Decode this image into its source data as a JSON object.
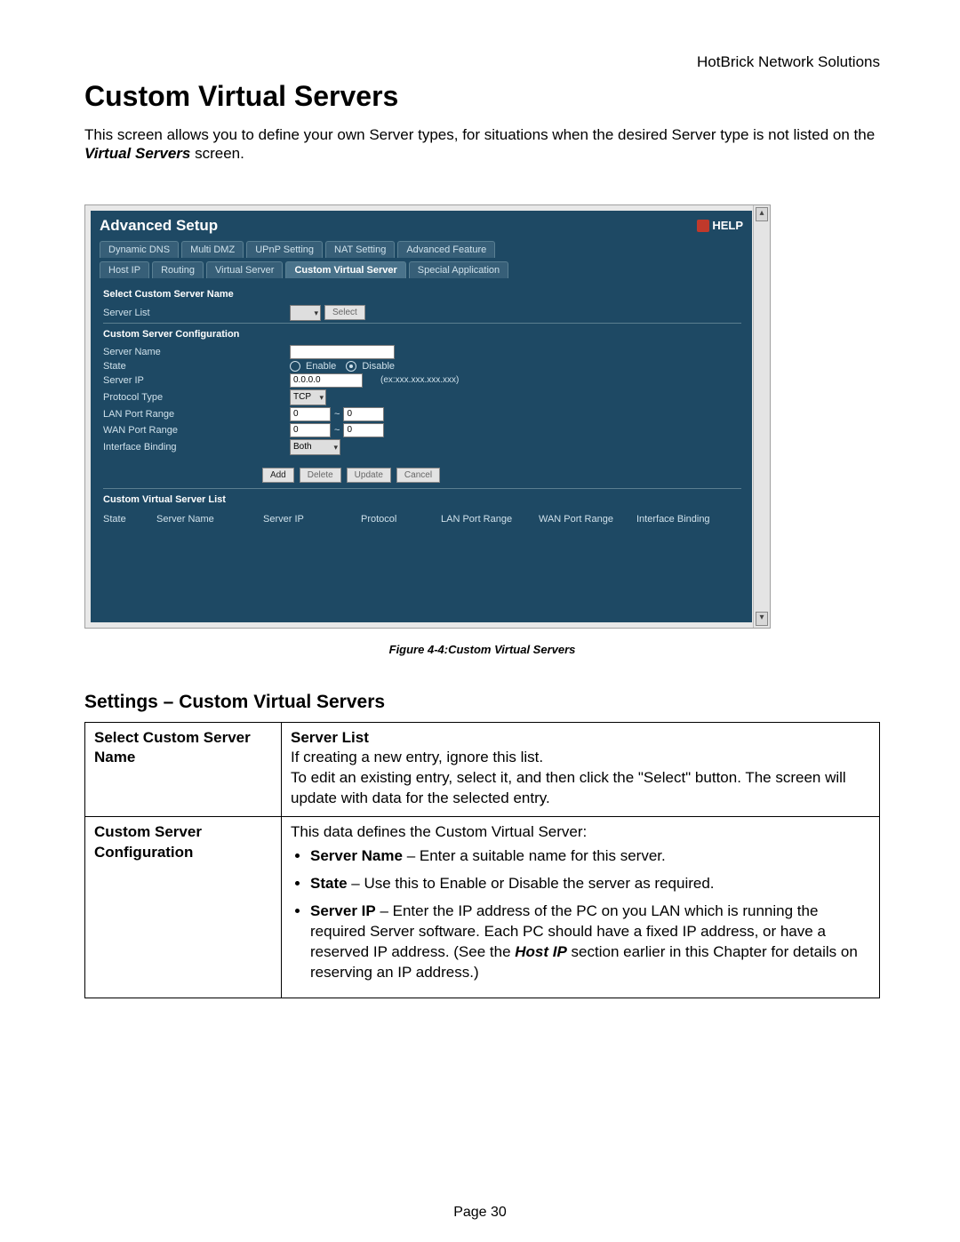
{
  "header": {
    "company": "HotBrick Network Solutions"
  },
  "title": "Custom Virtual Servers",
  "intro": {
    "line1": "This screen allows you to define your own Server types, for situations when the desired Server type is not listed on the ",
    "line1_bold": "Virtual Servers",
    "line1_after": " screen."
  },
  "screenshot": {
    "panel_title": "Advanced Setup",
    "help_label": "HELP",
    "tabs1": [
      "Dynamic DNS",
      "Multi DMZ",
      "UPnP Setting",
      "NAT Setting",
      "Advanced Feature"
    ],
    "tabs2": [
      "Host IP",
      "Routing",
      "Virtual Server",
      "Custom Virtual Server",
      "Special Application"
    ],
    "active_tab2_index": 3,
    "sec_select_head": "Select Custom Server Name",
    "server_list_label": "Server List",
    "select_btn": "Select",
    "sec_config_head": "Custom Server Configuration",
    "rows": {
      "server_name": "Server Name",
      "state": "State",
      "enable": "Enable",
      "disable": "Disable",
      "server_ip": "Server IP",
      "server_ip_val": "0.0.0.0",
      "ip_hint": "(ex:xxx.xxx.xxx.xxx)",
      "protocol_type": "Protocol Type",
      "protocol_val": "TCP",
      "lan_port": "LAN Port Range",
      "wan_port": "WAN Port Range",
      "port_default": "0",
      "tilde": "~",
      "iface": "Interface Binding",
      "iface_val": "Both"
    },
    "buttons": {
      "add": "Add",
      "delete": "Delete",
      "update": "Update",
      "cancel": "Cancel"
    },
    "sec_list_head": "Custom Virtual Server List",
    "list_cols": [
      "State",
      "Server Name",
      "Server IP",
      "Protocol",
      "LAN Port Range",
      "WAN Port Range",
      "Interface Binding"
    ]
  },
  "fig_caption": "Figure 4-4:Custom Virtual Servers",
  "settings_header": "Settings – Custom Virtual Servers",
  "table": {
    "r1_left": "Select Custom Server Name",
    "r1_right_head": "Server List",
    "r1_right_l1": "If creating a new entry, ignore this list.",
    "r1_right_l2": "To edit an existing entry, select it, and then click the \"Select\" button. The screen will update with data for the selected entry.",
    "r2_left": "Custom Server Configuration",
    "r2_intro": "This data defines the Custom Virtual Server:",
    "r2_b1_b": "Server Name",
    "r2_b1_t": " – Enter a suitable name for this server.",
    "r2_b2_b": "State",
    "r2_b2_t": " – Use this to Enable or Disable the server as required.",
    "r2_b3_b": "Server IP",
    "r2_b3_t": " – Enter the IP address of the PC on you LAN which is running the required Server software.\nEach PC should have a fixed IP address, or have a reserved IP address. (See the ",
    "r2_b3_bi": "Host IP",
    "r2_b3_t2": " section earlier in this Chapter for details on reserving an IP address.)"
  },
  "page_number": "Page 30"
}
